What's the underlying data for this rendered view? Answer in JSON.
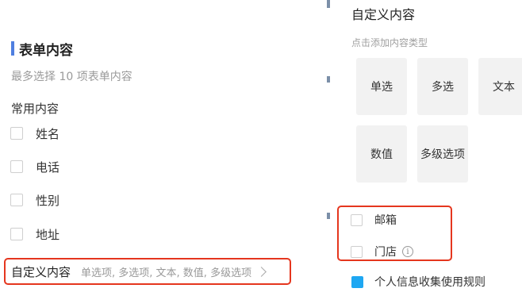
{
  "left": {
    "section_title": "表单内容",
    "hint": "最多选择 10 项表单内容",
    "group_title": "常用内容",
    "items": [
      {
        "label": "姓名",
        "checked": false
      },
      {
        "label": "电话",
        "checked": false
      },
      {
        "label": "性别",
        "checked": false
      },
      {
        "label": "地址",
        "checked": false
      }
    ],
    "custom": {
      "title": "自定义内容",
      "value": "单选项, 多选项, 文本, 数值, 多级选项"
    }
  },
  "right": {
    "title": "自定义内容",
    "hint": "点击添加内容类型",
    "types": [
      "单选",
      "多选",
      "文本",
      "数值",
      "多级选项"
    ],
    "items": [
      {
        "label": "邮箱",
        "checked": false
      },
      {
        "label": "门店",
        "checked": false,
        "icon": "info-icon"
      }
    ],
    "bottom_item": {
      "label": "个人信息收集使用规则",
      "checked": true
    }
  },
  "colors": {
    "accent": "#4f7fe0",
    "highlight": "#e5361e",
    "checkbox_checked": "#1ea7f2"
  }
}
